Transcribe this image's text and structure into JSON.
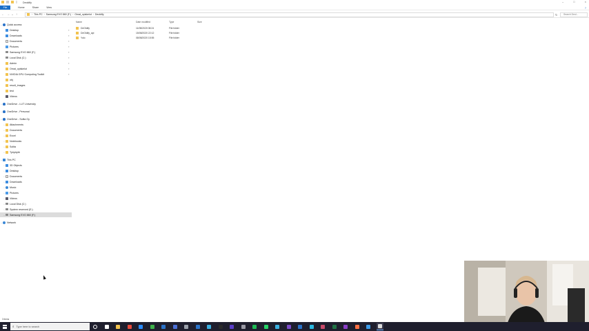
{
  "window": {
    "title": "Deoldify"
  },
  "ribbon": {
    "tabs": [
      "File",
      "Home",
      "Share",
      "View"
    ]
  },
  "address": {
    "crumbs": [
      "This PC",
      "Samsung EVO 860 (F:)",
      "Omat_opiskelut",
      "Deoldify"
    ],
    "search_placeholder": "Search Deol..."
  },
  "columns": {
    "name": "Name",
    "date": "Date modified",
    "type": "Type",
    "size": "Size"
  },
  "files": [
    {
      "name": "DeOldify",
      "date": "11/08/2020 08:24",
      "type": "File folder",
      "size": ""
    },
    {
      "name": "DeOldify_api",
      "date": "15/08/2020 22:12",
      "type": "File folder",
      "size": ""
    },
    {
      "name": "Yolo",
      "date": "08/08/2020 15:55",
      "type": "File folder",
      "size": ""
    }
  ],
  "nav": {
    "quick_access": "Quick access",
    "quick_items": [
      "Desktop",
      "Downloads",
      "Documents",
      "Pictures",
      "Samsung EVO 860 (F:)",
      "Local Disk (C:)",
      "Admin",
      "Omat_opiskelut",
      "NVIDIA GPU Computing Toolkit",
      "obj",
      "result_images",
      "test",
      "Videos"
    ],
    "onedrive_lut": "OneDrive - LUT University",
    "onedrive_personal": "OneDrive - Personal",
    "onedrive_solita": "OneDrive - Solita Oy",
    "solita_items": [
      "Attachments",
      "Documents",
      "Excel",
      "Notebooks",
      "Solita",
      "Työpöytä"
    ],
    "this_pc": "This PC",
    "pc_items": [
      "3D Objects",
      "Desktop",
      "Documents",
      "Downloads",
      "Music",
      "Pictures",
      "Videos",
      "Local Disk (C:)",
      "System reserved (E:)",
      "Samsung EVO 860 (F:)"
    ],
    "network": "Network"
  },
  "status": {
    "items": "3 items"
  },
  "taskbar": {
    "search_placeholder": "Type here to search",
    "app_colors": [
      "#ffffff",
      "#ffffff",
      "#f2c34f",
      "#e84a3c",
      "#2a8cff",
      "#3db04a",
      "#2a72c8",
      "#4a6fd6",
      "#9aa0aa",
      "#2a72c8",
      "#3aaee0",
      "#2b2b2b",
      "#5a3ec8",
      "#9a9aa5",
      "#1db954",
      "#25d366",
      "#3ab0e0",
      "#7a4ac8",
      "#2a72c8",
      "#2bb8e0",
      "#c84a6a",
      "#217346",
      "#8a3ec8",
      "#ff7043",
      "#3b9ae8",
      "#dcdcdc"
    ]
  }
}
